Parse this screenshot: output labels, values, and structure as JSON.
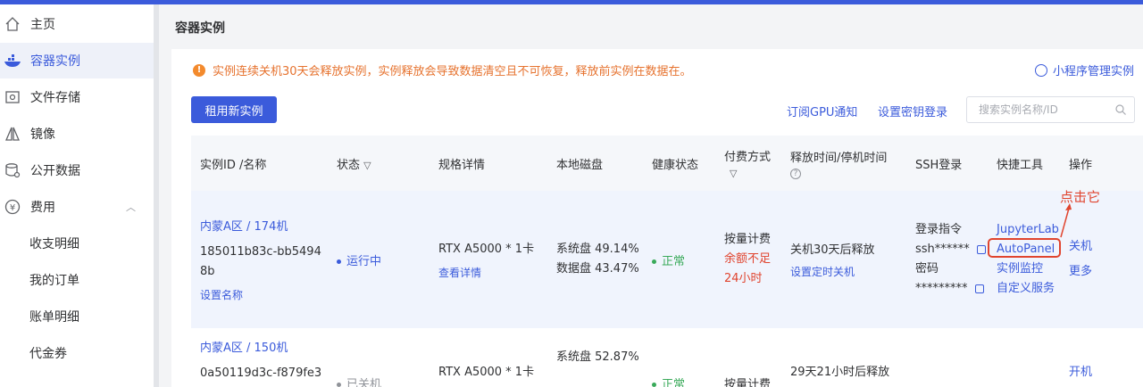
{
  "sidebar": {
    "items": [
      {
        "label": "主页",
        "icon": "home-icon"
      },
      {
        "label": "容器实例",
        "icon": "container-icon",
        "active": true
      },
      {
        "label": "文件存储",
        "icon": "storage-icon"
      },
      {
        "label": "镜像",
        "icon": "image-icon"
      },
      {
        "label": "公开数据",
        "icon": "database-icon"
      },
      {
        "label": "费用",
        "icon": "yuan-icon"
      }
    ],
    "sub_items": [
      "收支明细",
      "我的订单",
      "账单明细",
      "代金券"
    ]
  },
  "page": {
    "title": "容器实例",
    "alert": "实例连续关机30天会释放实例，实例释放会导致数据清空且不可恢复，释放前实例在数据在。",
    "mini_program_link": "小程序管理实例",
    "rent_button": "租用新实例",
    "subscribe_gpu": "订阅GPU通知",
    "set_key_login": "设置密钥登录",
    "search_placeholder": "搜索实例名称/ID"
  },
  "table": {
    "headers": [
      "实例ID /名称",
      "状态",
      "规格详情",
      "本地磁盘",
      "健康状态",
      "付费方式",
      "释放时间/停机时间",
      "SSH登录",
      "快捷工具",
      "操作"
    ],
    "rows": [
      {
        "name": "内蒙A区 / 174机",
        "id": "185011b83c-bb54948b",
        "set_name": "设置名称",
        "status": "运行中",
        "status_color": "#3b5bdb",
        "spec": "RTX A5000 * 1卡",
        "spec_detail": "查看详情",
        "disk_system": "系统盘 49.14%",
        "disk_data": "数据盘 43.47%",
        "health": "正常",
        "billing": "按量计费",
        "billing_warning": "余额不足24小时",
        "release": "关机30天后释放",
        "set_timer": "设置定时关机",
        "ssh_cmd_label": "登录指令",
        "ssh_cmd": "ssh******",
        "password_label": "密码",
        "password": "*********",
        "tools": [
          "JupyterLab",
          "AutoPanel",
          "实例监控",
          "自定义服务"
        ],
        "actions": [
          "关机",
          "更多"
        ]
      },
      {
        "name": "内蒙A区 / 150机",
        "id": "0a50119d3c-f879fe3",
        "status": "已关机",
        "spec": "RTX A5000 * 1卡",
        "disk_system": "系统盘 52.87%",
        "health": "正常",
        "billing": "按量计费",
        "release": "29天21小时后释放",
        "actions": [
          "开机"
        ]
      }
    ]
  },
  "annotation": {
    "text": "点击它",
    "color": "#e0442e"
  },
  "colors": {
    "brand": "#3b5bdb",
    "warning": "#e6722e",
    "success": "#3aaa5a",
    "danger": "#e0442e"
  }
}
